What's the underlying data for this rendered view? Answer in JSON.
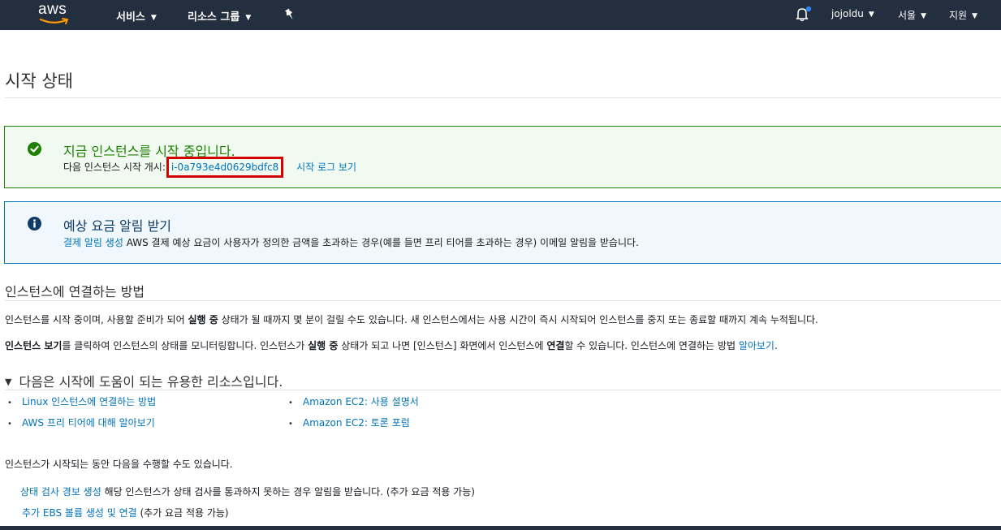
{
  "topbar": {
    "logo_text": "aws",
    "services": "서비스",
    "resource_groups": "리소스 그룹",
    "user": "jojoldu",
    "region": "서울",
    "support": "지원",
    "icons": [
      "bell-icon",
      "pin-icon",
      "chevron-down-icon"
    ]
  },
  "page": {
    "title": "시작 상태"
  },
  "success": {
    "title": "지금 인스턴스를 시작 중입니다.",
    "prefix": "다음 인스턴스 시작 개시:",
    "instance_id": "i-0a793e4d0629bdfc8",
    "log_link": "시작 로그 보기"
  },
  "billing": {
    "title": "예상 요금 알림 받기",
    "link": "결제 알림 생성",
    "text": "AWS 결제 예상 요금이 사용자가 정의한 금액을 초과하는 경우(예를 들면 프리 티어를 초과하는 경우) 이메일 알림을 받습니다."
  },
  "connect": {
    "heading": "인스턴스에 연결하는 방법",
    "p1_a": "인스턴스를 시작 중이며, 사용할 준비가 되어 ",
    "p1_bold": "실행 중",
    "p1_b": " 상태가 될 때까지 몇 분이 걸릴 수도 있습니다. 새 인스턴스에서는 사용 시간이 즉시 시작되어 인스턴스를 중지 또는 종료할 때까지 계속 누적됩니다.",
    "p2_bold1": "인스턴스 보기",
    "p2_a": "를 클릭하여 인스턴스의 상태를 모니터링합니다. 인스턴스가 ",
    "p2_bold2": "실행 중",
    "p2_b": " 상태가 되고 나면 [인스턴스] 화면에서 인스턴스에 ",
    "p2_bold3": "연결",
    "p2_c": "할 수 있습니다. 인스턴스에 연결하는 방법 ",
    "p2_link": "알아보기",
    "p2_end": "."
  },
  "resources": {
    "title": "다음은 시작에 도움이 되는 유용한 리소스입니다.",
    "left": [
      "Linux 인스턴스에 연결하는 방법",
      "AWS 프리 티어에 대해 알아보기"
    ],
    "right": [
      "Amazon EC2: 사용 설명서",
      "Amazon EC2: 토론 포럼"
    ]
  },
  "while": {
    "intro": "인스턴스가 시작되는 동안 다음을 수행할 수도 있습니다.",
    "item1_link": "상태 검사 경보 생성",
    "item1_text": " 해당 인스턴스가 상태 검사를 통과하지 못하는 경우 알림을 받습니다. (추가 요금 적용 가능)",
    "item2_link": "추가 EBS 볼륨 생성 및 연결",
    "item2_text": " (추가 요금 적용 가능)"
  },
  "colors": {
    "header": "#232f3e",
    "success": "#1d8102",
    "info": "#0073bb",
    "link": "#0073bb",
    "highlight": "#d50000"
  }
}
